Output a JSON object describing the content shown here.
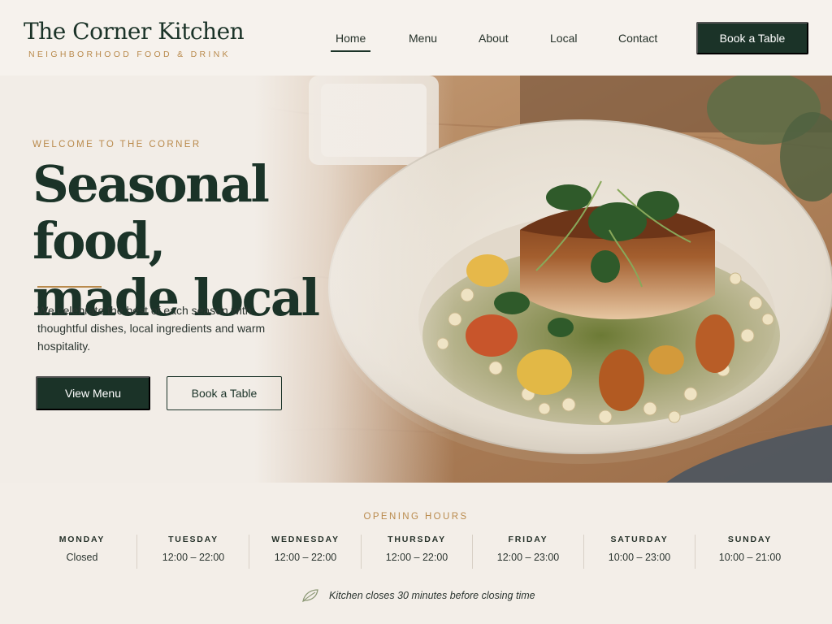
{
  "brand": {
    "name": "The Corner Kitchen",
    "tagline": "NEIGHBORHOOD FOOD & DRINK"
  },
  "nav": {
    "items": [
      "Home",
      "Menu",
      "About",
      "Local",
      "Contact"
    ],
    "active": "Home",
    "cta_label": "Book a Table"
  },
  "hero": {
    "eyebrow": "WELCOME TO THE CORNER",
    "headline_line1": "Seasonal food,",
    "headline_line2": "made local",
    "intro": "We celebrate the best of each season with thoughtful dishes, local ingredients and warm hospitality.",
    "primary_button": "View Menu",
    "secondary_button": "Book a Table"
  },
  "hours": {
    "title": "OPENING HOURS",
    "days": [
      {
        "day": "MONDAY",
        "time": "Closed"
      },
      {
        "day": "TUESDAY",
        "time": "12:00 – 22:00"
      },
      {
        "day": "WEDNESDAY",
        "time": "12:00 – 22:00"
      },
      {
        "day": "THURSDAY",
        "time": "12:00 – 22:00"
      },
      {
        "day": "FRIDAY",
        "time": "12:00 – 23:00"
      },
      {
        "day": "SATURDAY",
        "time": "10:00 – 23:00"
      },
      {
        "day": "SUNDAY",
        "time": "10:00 – 21:00"
      }
    ],
    "note": "Kitchen closes 30 minutes before closing time",
    "note_icon": "leaf-icon"
  },
  "colors": {
    "forest": "#1b3328",
    "gold": "#b98a4c",
    "cream": "#f5f1ec",
    "wood": "#b78b63"
  }
}
